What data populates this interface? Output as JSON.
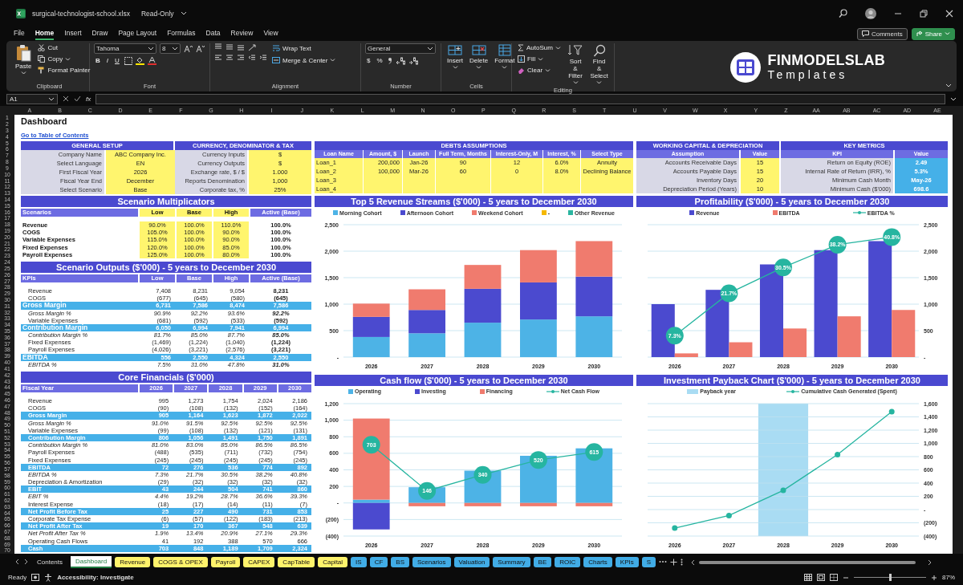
{
  "window": {
    "title": "surgical-technologist-school.xlsx",
    "status": "Read-Only"
  },
  "menu": [
    {
      "label": "File",
      "selected": false
    },
    {
      "label": "Home",
      "selected": true
    },
    {
      "label": "Insert",
      "selected": false
    },
    {
      "label": "Draw",
      "selected": false
    },
    {
      "label": "Page Layout",
      "selected": false
    },
    {
      "label": "Formulas",
      "selected": false
    },
    {
      "label": "Data",
      "selected": false
    },
    {
      "label": "Review",
      "selected": false
    },
    {
      "label": "View",
      "selected": false
    }
  ],
  "header_buttons": {
    "comments": "Comments",
    "share": "Share"
  },
  "ribbon": {
    "clipboard": {
      "paste": "Paste",
      "cut": "Cut",
      "copy": "Copy",
      "format_painter": "Format Painter",
      "label": "Clipboard"
    },
    "font": {
      "font_name": "Tahoma",
      "font_size": "8",
      "styles": [
        "B",
        "I",
        "U"
      ],
      "label": "Font"
    },
    "alignment": {
      "wrap_text": "Wrap Text",
      "merge": "Merge & Center",
      "label": "Alignment"
    },
    "number": {
      "format": "General",
      "symbols": [
        "$",
        "%"
      ],
      "label": "Number"
    },
    "cells": {
      "buttons": [
        "Insert",
        "Delete",
        "Format"
      ],
      "label": "Cells"
    },
    "editing": {
      "autosum": "AutoSum",
      "fill": "Fill",
      "clear": "Clear",
      "sort": "Sort & Filter",
      "find": "Find & Select",
      "label": "Editing"
    },
    "logo": {
      "brand": "FINMODELSLAB",
      "tagline": "Templates"
    }
  },
  "formula_bar": {
    "name_box": "A1",
    "function_label": "fx"
  },
  "column_headers": [
    "A",
    "B",
    "C",
    "D",
    "E",
    "F",
    "G",
    "H",
    "I",
    "J",
    "K",
    "L",
    "M",
    "N",
    "O",
    "P",
    "Q",
    "R",
    "S",
    "T",
    "U",
    "V",
    "W",
    "X",
    "Y",
    "Z",
    "AA",
    "AB",
    "AC",
    "AD",
    "AE"
  ],
  "row_headers": [
    "1",
    "2",
    "3",
    "4",
    "5",
    "6",
    "7",
    "8",
    "9",
    "10",
    "11",
    "12",
    "13",
    "14",
    "15",
    "16",
    "17",
    "18",
    "19",
    "20",
    "21",
    "22",
    "23",
    "24",
    "25",
    "26",
    "27",
    "28",
    "29",
    "30",
    "31",
    "32",
    "33",
    "34",
    "35",
    "36",
    "37",
    "38",
    "39",
    "40",
    "41",
    "42",
    "43",
    "44",
    "45",
    "46",
    "47",
    "48",
    "49",
    "50",
    "51",
    "52",
    "53",
    "54",
    "55",
    "56",
    "57",
    "58",
    "59",
    "60",
    "61",
    "62",
    "63",
    "64",
    "65",
    "66",
    "67",
    "68",
    "69",
    "70"
  ],
  "sheet": {
    "dashboard": {
      "title": "Dashboard",
      "link": "Go to Table of Contents"
    },
    "general_setup": {
      "title": "GENERAL SETUP",
      "rows": [
        {
          "label": "Company Name",
          "value": "ABC Company Inc."
        },
        {
          "label": "Select Language",
          "value": "EN"
        },
        {
          "label": "First Fiscal Year",
          "value": "2026"
        },
        {
          "label": "Fiscal Year End",
          "value": "December"
        },
        {
          "label": "Select Scenario",
          "value": "Base"
        }
      ]
    },
    "currency": {
      "title": "CURRENCY, DENOMINATOR & TAX",
      "rows": [
        {
          "label": "Currency Inputs",
          "value": "$"
        },
        {
          "label": "Currency Outputs",
          "value": "$"
        },
        {
          "label": "Exchange rate, $ / $",
          "value": "1.000"
        },
        {
          "label": "Reports Denomination",
          "value": "1,000"
        },
        {
          "label": "Corporate tax, %",
          "value": "25%"
        }
      ]
    },
    "debts": {
      "title": "DEBTS ASSUMPTIONS",
      "columns": [
        "Loan Name",
        "Amount, $",
        "Launch",
        "Full Term, Months",
        "Interest-Only, M",
        "Interest, %",
        "Select Type"
      ],
      "rows": [
        {
          "name": "Loan_1",
          "values": [
            "200,000",
            "Jan-26",
            "90",
            "12",
            "6.0%",
            "Annuity"
          ]
        },
        {
          "name": "Loan_2",
          "values": [
            "100,000",
            "Mar-26",
            "60",
            "0",
            "8.0%",
            "Declining Balance"
          ]
        },
        {
          "name": "Loan_3"
        },
        {
          "name": "Loan_4"
        }
      ]
    },
    "working_capital": {
      "title": "WORKING CAPITAL & DEPRECIATION",
      "columns": [
        "Assumption",
        "Value"
      ],
      "rows": [
        {
          "label": "Accounts Receivable Days",
          "value": "15"
        },
        {
          "label": "Accounts Payable Days",
          "value": "15"
        },
        {
          "label": "Inventory Days",
          "value": "20"
        },
        {
          "label": "Depreciation Period (Years)",
          "value": "10"
        }
      ]
    },
    "key_metrics": {
      "title": "KEY METRICS",
      "columns": [
        "KPI",
        "Value"
      ],
      "rows": [
        {
          "label": "Return on Equity (ROE)",
          "value": "2.49"
        },
        {
          "label": "Internal Rate of Return (IRR), %",
          "value": "5.3%"
        },
        {
          "label": "Minimum Cash Month",
          "value": "May-26"
        },
        {
          "label": "Minimum Cash ($'000)",
          "value": "698.6"
        }
      ]
    },
    "scenario_multiplicators": {
      "title": "Scenario Multiplicators",
      "columns": [
        "Scenarios",
        "Low",
        "Base",
        "High",
        "Active (Base)"
      ],
      "rows": [
        {
          "label": "Revenue",
          "values": [
            "90.0%",
            "100.0%",
            "110.0%",
            "100.0%"
          ]
        },
        {
          "label": "COGS",
          "values": [
            "105.0%",
            "100.0%",
            "90.0%",
            "100.0%"
          ]
        },
        {
          "label": "Variable Expenses",
          "values": [
            "115.0%",
            "100.0%",
            "90.0%",
            "100.0%"
          ]
        },
        {
          "label": "Fixed Expenses",
          "values": [
            "120.0%",
            "100.0%",
            "85.0%",
            "100.0%"
          ]
        },
        {
          "label": "Payroll Expenses",
          "values": [
            "125.0%",
            "100.0%",
            "80.0%",
            "100.0%"
          ]
        }
      ]
    },
    "scenario_outputs": {
      "title": "Scenario Outputs ($'000) - 5 years to December 2030",
      "columns": [
        "KPIs",
        "Low",
        "Base",
        "High",
        "Active (Base)"
      ],
      "rows": [
        {
          "label": "Revenue",
          "kind": "item",
          "values": [
            "7,408",
            "8,231",
            "9,054",
            "8,231"
          ]
        },
        {
          "label": "COGS",
          "kind": "item",
          "values": [
            "(677)",
            "(645)",
            "(580)",
            "(645)"
          ]
        },
        {
          "label": "Gross Margin",
          "kind": "total",
          "values": [
            "6,731",
            "7,586",
            "8,474",
            "7,586"
          ]
        },
        {
          "label": "Gross Margin %",
          "kind": "percent",
          "values": [
            "90.9%",
            "92.2%",
            "93.6%",
            "92.2%"
          ]
        },
        {
          "label": "Variable Expenses",
          "kind": "item",
          "values": [
            "(681)",
            "(592)",
            "(533)",
            "(592)"
          ]
        },
        {
          "label": "Contribution Margin",
          "kind": "total",
          "values": [
            "6,050",
            "6,994",
            "7,941",
            "6,994"
          ]
        },
        {
          "label": "Contribution Margin %",
          "kind": "percent",
          "values": [
            "81.7%",
            "85.0%",
            "87.7%",
            "85.0%"
          ]
        },
        {
          "label": "Fixed Expenses",
          "kind": "item",
          "values": [
            "(1,469)",
            "(1,224)",
            "(1,040)",
            "(1,224)"
          ]
        },
        {
          "label": "Payroll Expenses",
          "kind": "item",
          "values": [
            "(4,026)",
            "(3,221)",
            "(2,576)",
            "(3,221)"
          ]
        },
        {
          "label": "EBITDA",
          "kind": "total",
          "values": [
            "556",
            "2,550",
            "4,324",
            "2,550"
          ]
        },
        {
          "label": "EBITDA %",
          "kind": "percent",
          "values": [
            "7.5%",
            "31.0%",
            "47.8%",
            "31.0%"
          ]
        }
      ]
    },
    "core_financials": {
      "title": "Core Financials ($'000)",
      "columns": [
        "Fiscal Year",
        "2026",
        "2027",
        "2028",
        "2029",
        "2030"
      ],
      "rows": [
        {
          "label": "Revenue",
          "kind": "item",
          "values": [
            "995",
            "1,273",
            "1,754",
            "2,024",
            "2,186"
          ]
        },
        {
          "label": "COGS",
          "kind": "item",
          "values": [
            "(90)",
            "(108)",
            "(132)",
            "(152)",
            "(164)"
          ]
        },
        {
          "label": "Gross Margin",
          "kind": "total",
          "values": [
            "905",
            "1,164",
            "1,623",
            "1,872",
            "2,022"
          ]
        },
        {
          "label": "Gross Margin %",
          "kind": "percent",
          "values": [
            "91.0%",
            "91.5%",
            "92.5%",
            "92.5%",
            "92.5%"
          ]
        },
        {
          "label": "Variable Expenses",
          "kind": "item",
          "values": [
            "(99)",
            "(108)",
            "(132)",
            "(121)",
            "(131)"
          ]
        },
        {
          "label": "Contribution Margin",
          "kind": "total",
          "values": [
            "806",
            "1,056",
            "1,491",
            "1,750",
            "1,891"
          ]
        },
        {
          "label": "Contribution Margin %",
          "kind": "percent",
          "values": [
            "81.0%",
            "83.0%",
            "85.0%",
            "86.5%",
            "86.5%"
          ]
        },
        {
          "label": "Payroll Expenses",
          "kind": "item",
          "values": [
            "(488)",
            "(535)",
            "(711)",
            "(732)",
            "(754)"
          ]
        },
        {
          "label": "Fixed Expenses",
          "kind": "item",
          "values": [
            "(245)",
            "(245)",
            "(245)",
            "(245)",
            "(245)"
          ]
        },
        {
          "label": "EBITDA",
          "kind": "total",
          "values": [
            "72",
            "276",
            "536",
            "774",
            "892"
          ]
        },
        {
          "label": "EBITDA %",
          "kind": "percent",
          "values": [
            "7.3%",
            "21.7%",
            "30.5%",
            "38.2%",
            "40.8%"
          ]
        },
        {
          "label": "Depreciation & Amortization",
          "kind": "item",
          "values": [
            "(29)",
            "(32)",
            "(32)",
            "(32)",
            "(32)"
          ]
        },
        {
          "label": "EBIT",
          "kind": "total",
          "values": [
            "43",
            "244",
            "504",
            "741",
            "860"
          ]
        },
        {
          "label": "EBIT %",
          "kind": "percent",
          "values": [
            "4.4%",
            "19.2%",
            "28.7%",
            "36.6%",
            "39.3%"
          ]
        },
        {
          "label": "Interest Expense",
          "kind": "item",
          "values": [
            "(18)",
            "(17)",
            "(14)",
            "(11)",
            "(7)"
          ]
        },
        {
          "label": "Net Profit Before Tax",
          "kind": "total",
          "values": [
            "25",
            "227",
            "490",
            "731",
            "853"
          ]
        },
        {
          "label": "Corporate Tax Expense",
          "kind": "item",
          "values": [
            "(6)",
            "(57)",
            "(122)",
            "(183)",
            "(213)"
          ]
        },
        {
          "label": "Net Profit After Tax",
          "kind": "total",
          "values": [
            "19",
            "170",
            "367",
            "548",
            "639"
          ]
        },
        {
          "label": "Net Profit After Tax %",
          "kind": "percent",
          "values": [
            "1.9%",
            "13.4%",
            "20.9%",
            "27.1%",
            "29.3%"
          ]
        },
        {
          "label": "Operating Cash Flows",
          "kind": "item",
          "values": [
            "41",
            "192",
            "388",
            "570",
            "666"
          ]
        },
        {
          "label": "Cash",
          "kind": "total",
          "values": [
            "703",
            "848",
            "1,189",
            "1,709",
            "2,324"
          ]
        }
      ]
    },
    "charts": [
      {
        "title": "Top 5 Revenue Streams ($'000) - 5 years to December 2030",
        "chart_data": {
          "type": "bar",
          "stacked": true,
          "grid": true,
          "legend": "top",
          "categories": [
            "2026",
            "2027",
            "2028",
            "2029",
            "2030"
          ],
          "ylim": [
            0,
            2500
          ],
          "yticks": [
            {
              "value": 0,
              "label": "-"
            },
            {
              "value": 500,
              "label": "500"
            },
            {
              "value": 1000,
              "label": "1,000"
            },
            {
              "value": 1500,
              "label": "1,500"
            },
            {
              "value": 2000,
              "label": "2,000"
            },
            {
              "value": 2500,
              "label": "2,500"
            }
          ],
          "series": [
            {
              "name": "Morning Cohort",
              "color": "#4db3e6",
              "values": [
                380,
                450,
                650,
                710,
                770
              ]
            },
            {
              "name": "Afternoon Cohort",
              "color": "#4b4acf",
              "values": [
                380,
                440,
                640,
                700,
                750
              ]
            },
            {
              "name": "Weekend Cohort",
              "color": "#f07b6e",
              "values": [
                250,
                390,
                450,
                610,
                670
              ]
            },
            {
              "name": "-",
              "color": "#f5b800",
              "values": [
                0,
                0,
                0,
                0,
                0
              ]
            },
            {
              "name": "Other Revenue",
              "color": "#2bb5a0",
              "values": [
                0,
                0,
                0,
                0,
                0
              ]
            }
          ]
        }
      },
      {
        "title": "Profitability ($'000) - 5 years to December 2030",
        "chart_data": {
          "type": "bar",
          "stacked": false,
          "grid": true,
          "legend": "top",
          "categories": [
            "2026",
            "2027",
            "2028",
            "2029",
            "2030"
          ],
          "ylim": [
            0,
            2500
          ],
          "y2lim": [
            0,
            45
          ],
          "yticks": [
            {
              "value": 0,
              "label": "-"
            },
            {
              "value": 500,
              "label": "500"
            },
            {
              "value": 1000,
              "label": "1,000"
            },
            {
              "value": 1500,
              "label": "1,500"
            },
            {
              "value": 2000,
              "label": "2,000"
            },
            {
              "value": 2500,
              "label": "2,500"
            }
          ],
          "series": [
            {
              "name": "Revenue",
              "color": "#4b4acf",
              "values": [
                1000,
                1270,
                1750,
                2020,
                2190
              ]
            },
            {
              "name": "EBITDA",
              "color": "#f07b6e",
              "values": [
                70,
                280,
                540,
                770,
                890
              ]
            },
            {
              "name": "EBITDA %",
              "type": "line",
              "axis": "y2",
              "marker": "circle",
              "color": "#26b5a0",
              "values": [
                7.3,
                21.7,
                30.5,
                38.2,
                40.8
              ],
              "value_labels": [
                "7.3%",
                "21.7%",
                "30.5%",
                "38.2%",
                "40.8%"
              ]
            }
          ]
        }
      },
      {
        "title": "Cash flow ($'000) - 5 years to December 2030",
        "chart_data": {
          "type": "bar",
          "stacked": true,
          "grid": true,
          "legend": "top",
          "categories": [
            "2026",
            "2027",
            "2028",
            "2029",
            "2030"
          ],
          "ylim": [
            -400,
            1200
          ],
          "yticks": [
            {
              "value": -400,
              "label": "(400)"
            },
            {
              "value": -200,
              "label": "(200)"
            },
            {
              "value": 0,
              "label": "-"
            },
            {
              "value": 200,
              "label": "200"
            },
            {
              "value": 400,
              "label": "400"
            },
            {
              "value": 600,
              "label": "600"
            },
            {
              "value": 800,
              "label": "800"
            },
            {
              "value": 1000,
              "label": "1,000"
            },
            {
              "value": 1200,
              "label": "1,200"
            }
          ],
          "series": [
            {
              "name": "Operating",
              "color": "#4db3e6",
              "values": [
                40,
                190,
                390,
                570,
                660
              ]
            },
            {
              "name": "Investing",
              "color": "#4b4acf",
              "values": [
                -320,
                0,
                0,
                0,
                0
              ]
            },
            {
              "name": "Financing",
              "color": "#f07b6e",
              "values": [
                980,
                -40,
                -40,
                -40,
                -40
              ]
            },
            {
              "name": "Net Cash Flow",
              "type": "line",
              "marker": "circle",
              "color": "#26b5a0",
              "values": [
                703,
                146,
                340,
                520,
                615
              ],
              "value_labels": [
                "703",
                "146",
                "340",
                "520",
                "615"
              ]
            }
          ]
        }
      },
      {
        "title": "Investment Payback Chart ($'000) - 5 years to December 2030",
        "shade": {
          "label": "Payback year",
          "category": "2028",
          "color": "#a9dcf3"
        },
        "chart_data": {
          "type": "line",
          "grid": true,
          "legend": "top",
          "categories": [
            "2026",
            "2027",
            "2028",
            "2029",
            "2030"
          ],
          "ylim": [
            -400,
            1600
          ],
          "yticks": [
            {
              "value": -400,
              "label": "(400)"
            },
            {
              "value": -200,
              "label": "(200)"
            },
            {
              "value": 0,
              "label": "-"
            },
            {
              "value": 200,
              "label": "200"
            },
            {
              "value": 400,
              "label": "400"
            },
            {
              "value": 600,
              "label": "600"
            },
            {
              "value": 800,
              "label": "800"
            },
            {
              "value": 1000,
              "label": "1,000"
            },
            {
              "value": 1200,
              "label": "1,200"
            },
            {
              "value": 1400,
              "label": "1,400"
            },
            {
              "value": 1600,
              "label": "1,600"
            }
          ],
          "series": [
            {
              "name": "Cumulative Cash Generated (Spent)",
              "marker": "circle",
              "color": "#26b5a0",
              "values": [
                -280,
                -90,
                290,
                830,
                1480
              ]
            }
          ]
        }
      }
    ]
  },
  "sheet_tabs": [
    {
      "label": "Contents",
      "selected": false
    },
    {
      "label": "Dashboard",
      "selected": true
    },
    {
      "label": "Revenue",
      "selected": false,
      "color": "#fff36b"
    },
    {
      "label": "COGS & OPEX",
      "selected": false,
      "color": "#fff36b"
    },
    {
      "label": "Payroll",
      "selected": false,
      "color": "#fff36b"
    },
    {
      "label": "CAPEX",
      "selected": false,
      "color": "#fff36b"
    },
    {
      "label": "CapTable",
      "selected": false,
      "color": "#fff36b"
    },
    {
      "label": "Capital",
      "selected": false,
      "color": "#fff36b"
    },
    {
      "label": "IS",
      "selected": false,
      "color": "#41ace6"
    },
    {
      "label": "CF",
      "selected": false,
      "color": "#41ace6"
    },
    {
      "label": "BS",
      "selected": false,
      "color": "#41ace6"
    },
    {
      "label": "Scenarios",
      "selected": false,
      "color": "#41ace6"
    },
    {
      "label": "Valuation",
      "selected": false,
      "color": "#41ace6"
    },
    {
      "label": "Summary",
      "selected": false,
      "color": "#41ace6"
    },
    {
      "label": "BE",
      "selected": false,
      "color": "#41ace6"
    },
    {
      "label": "ROIC",
      "selected": false,
      "color": "#41ace6"
    },
    {
      "label": "Charts",
      "selected": false,
      "color": "#41ace6"
    },
    {
      "label": "KPIs",
      "selected": false,
      "color": "#41ace6"
    },
    {
      "label": "S",
      "selected": false,
      "color": "#41ace6"
    }
  ],
  "status_bar": {
    "ready": "Ready",
    "accessibility": "Accessibility: Investigate",
    "zoom": "87%",
    "zoom_slider": {
      "level": 0.5
    }
  }
}
